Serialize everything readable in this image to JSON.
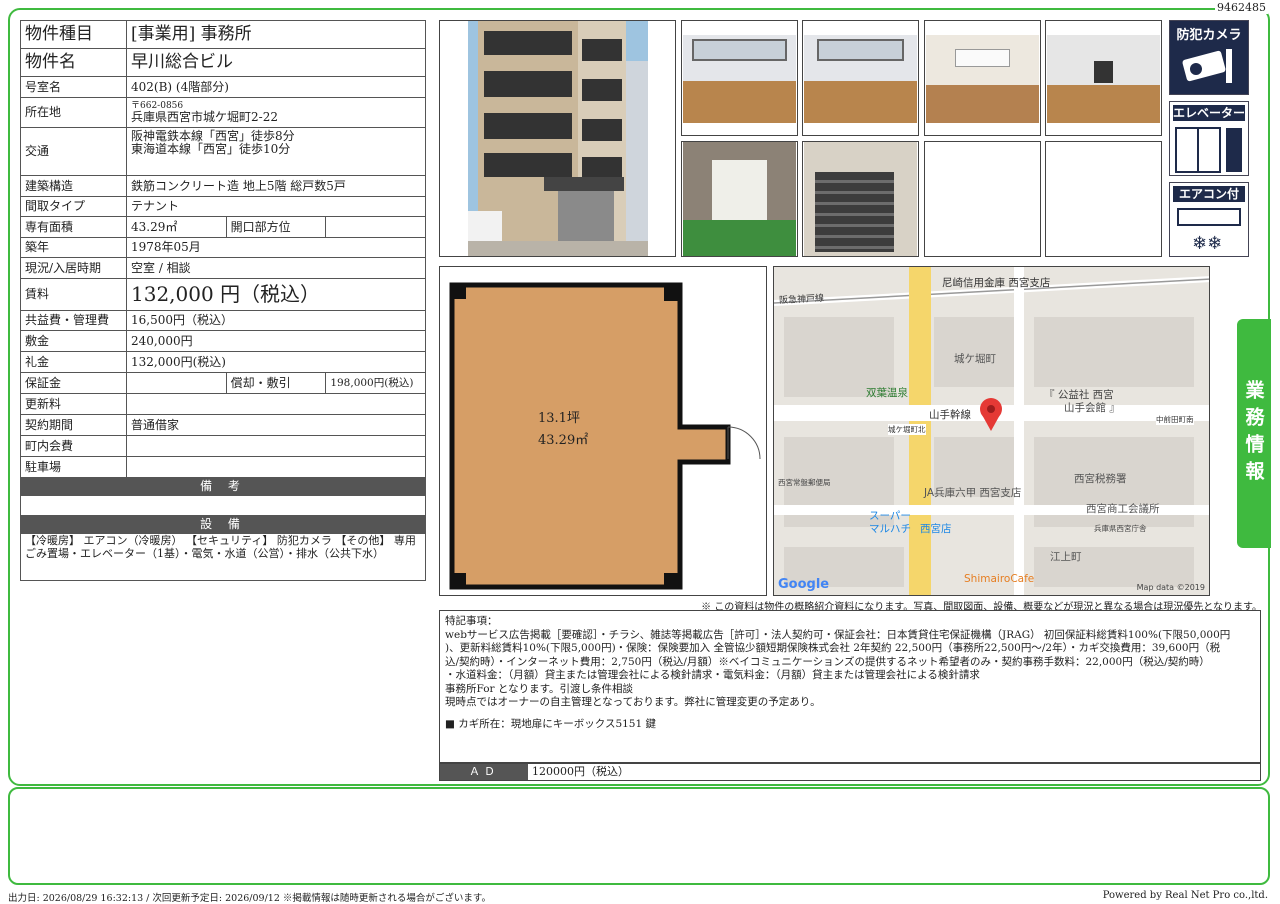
{
  "doc_id": "9462485",
  "property": {
    "type_label": "物件種目",
    "type_value": "[事業用] 事務所",
    "name_label": "物件名",
    "name_value": "早川総合ビル",
    "room_label": "号室名",
    "room_value": "402(B) (4階部分)",
    "address_label": "所在地",
    "postal": "〒662-0856",
    "address": "兵庫県西宮市城ケ堀町2-22",
    "access_label": "交通",
    "access_1": "阪神電鉄本線「西宮」徒歩8分",
    "access_2": "東海道本線「西宮」徒歩10分",
    "structure_label": "建築構造",
    "structure_value": "鉄筋コンクリート造 地上5階 総戸数5戸",
    "layout_label": "間取タイプ",
    "layout_value": "テナント",
    "area_label": "専有面積",
    "area_value": "43.29㎡",
    "opening_label": "開口部方位",
    "opening_value": "",
    "built_label": "築年",
    "built_value": "1978年05月",
    "status_label": "現況/入居時期",
    "status_value": "空室 / 相談",
    "rent_label": "賃料",
    "rent_value": "132,000 円（税込）",
    "fee_label": "共益費・管理費",
    "fee_value": "16,500円（税込）",
    "deposit_label": "敷金",
    "deposit_value": "240,000円",
    "key_money_label": "礼金",
    "key_money_value": "132,000円(税込)",
    "guarantee_label": "保証金",
    "guarantee_value": "",
    "amort_label": "償却・敷引",
    "amort_value": "198,000円(税込)",
    "renewal_label": "更新料",
    "renewal_value": "",
    "contract_label": "契約期間",
    "contract_value": "普通借家",
    "assoc_label": "町内会費",
    "assoc_value": "",
    "parking_label": "駐車場",
    "parking_value": "",
    "remarks_header": "備 考",
    "equip_header": "設 備",
    "equip_text": "【冷暖房】 エアコン（冷暖房） 【セキュリティ】 防犯カメラ 【その他】 専用ごみ置場・エレベーター（1基）・電気・水道（公営）・排水（公共下水）"
  },
  "features": {
    "camera": "防犯カメラ",
    "elevator": "エレベーター",
    "aircon": "エアコン付"
  },
  "side_tab": "業務情報",
  "floorplan": {
    "tsubo": "13.1坪",
    "sqm": "43.29㎡"
  },
  "map": {
    "labels": {
      "bank": "尼崎信用金庫 西宮支店",
      "rail": "阪急神戸線",
      "jogabori": "城ケ堀町",
      "onsen": "双葉温泉",
      "kobe_public": "『 公益社 西宮",
      "kobe_public2": "山手会館 』",
      "yamate": "山手幹線",
      "nakamaeda": "中前田町南",
      "jogabori_kita": "城ケ堀町北",
      "post": "西宮常盤郵便局",
      "ja": "JA兵庫六甲 西宮支店",
      "tax": "西宮税務署",
      "super1": "スーパー",
      "super2": "マルハチ",
      "super3": "西宮店",
      "chamber": "西宮商工会議所",
      "pref": "兵庫県西宮庁舎",
      "egamicho": "江上町",
      "cafe": "ShimairoCafe",
      "google": "Google",
      "mapdata": "Map data ©2019"
    }
  },
  "disclaimer": "※ この資料は物件の概略紹介資料になります。写真、間取図面、設備、概要などが現況と異なる場合は現況優先となります。",
  "notes": {
    "title": "特記事項：",
    "line1": "webサービス広告掲載［要確認］・チラシ、雑誌等掲載広告［許可］・法人契約可・保証会社：日本賃貸住宅保証機構（JRAG） 初回保証料総賃料100%(下限50,000円",
    "line2": ")、更新料総賃料10%(下限5,000円)・保険：保険要加入 全管協少額短期保険株式会社 2年契約 22,500円（事務所22,500円～/2年）・カギ交換費用：39,600円（税",
    "line3": "込/契約時）・インターネット費用：2,750円（税込/月額）※ベイコミュニケーションズの提供するネット希望者のみ・契約事務手数料：22,000円（税込/契約時）",
    "line4": "・水道料金：（月額）貸主または管理会社による検針請求・電気料金：（月額）貸主または管理会社による検針請求",
    "line5": "事務所For となります。引渡し条件相談",
    "line6": "現時点ではオーナーの自主管理となっております。弊社に管理変更の予定あり。",
    "line7": "■ カギ所在：現地扉にキーボックス5151 鍵"
  },
  "ad": {
    "label": "ＡＤ",
    "value": "120000円（税込）"
  },
  "footer": {
    "left": "出力日: 2026/08/29 16:32:13 / 次回更新予定日: 2026/09/12 ※掲載情報は随時更新される場合がございます。",
    "right": "Powered by Real Net Pro co.,ltd."
  }
}
